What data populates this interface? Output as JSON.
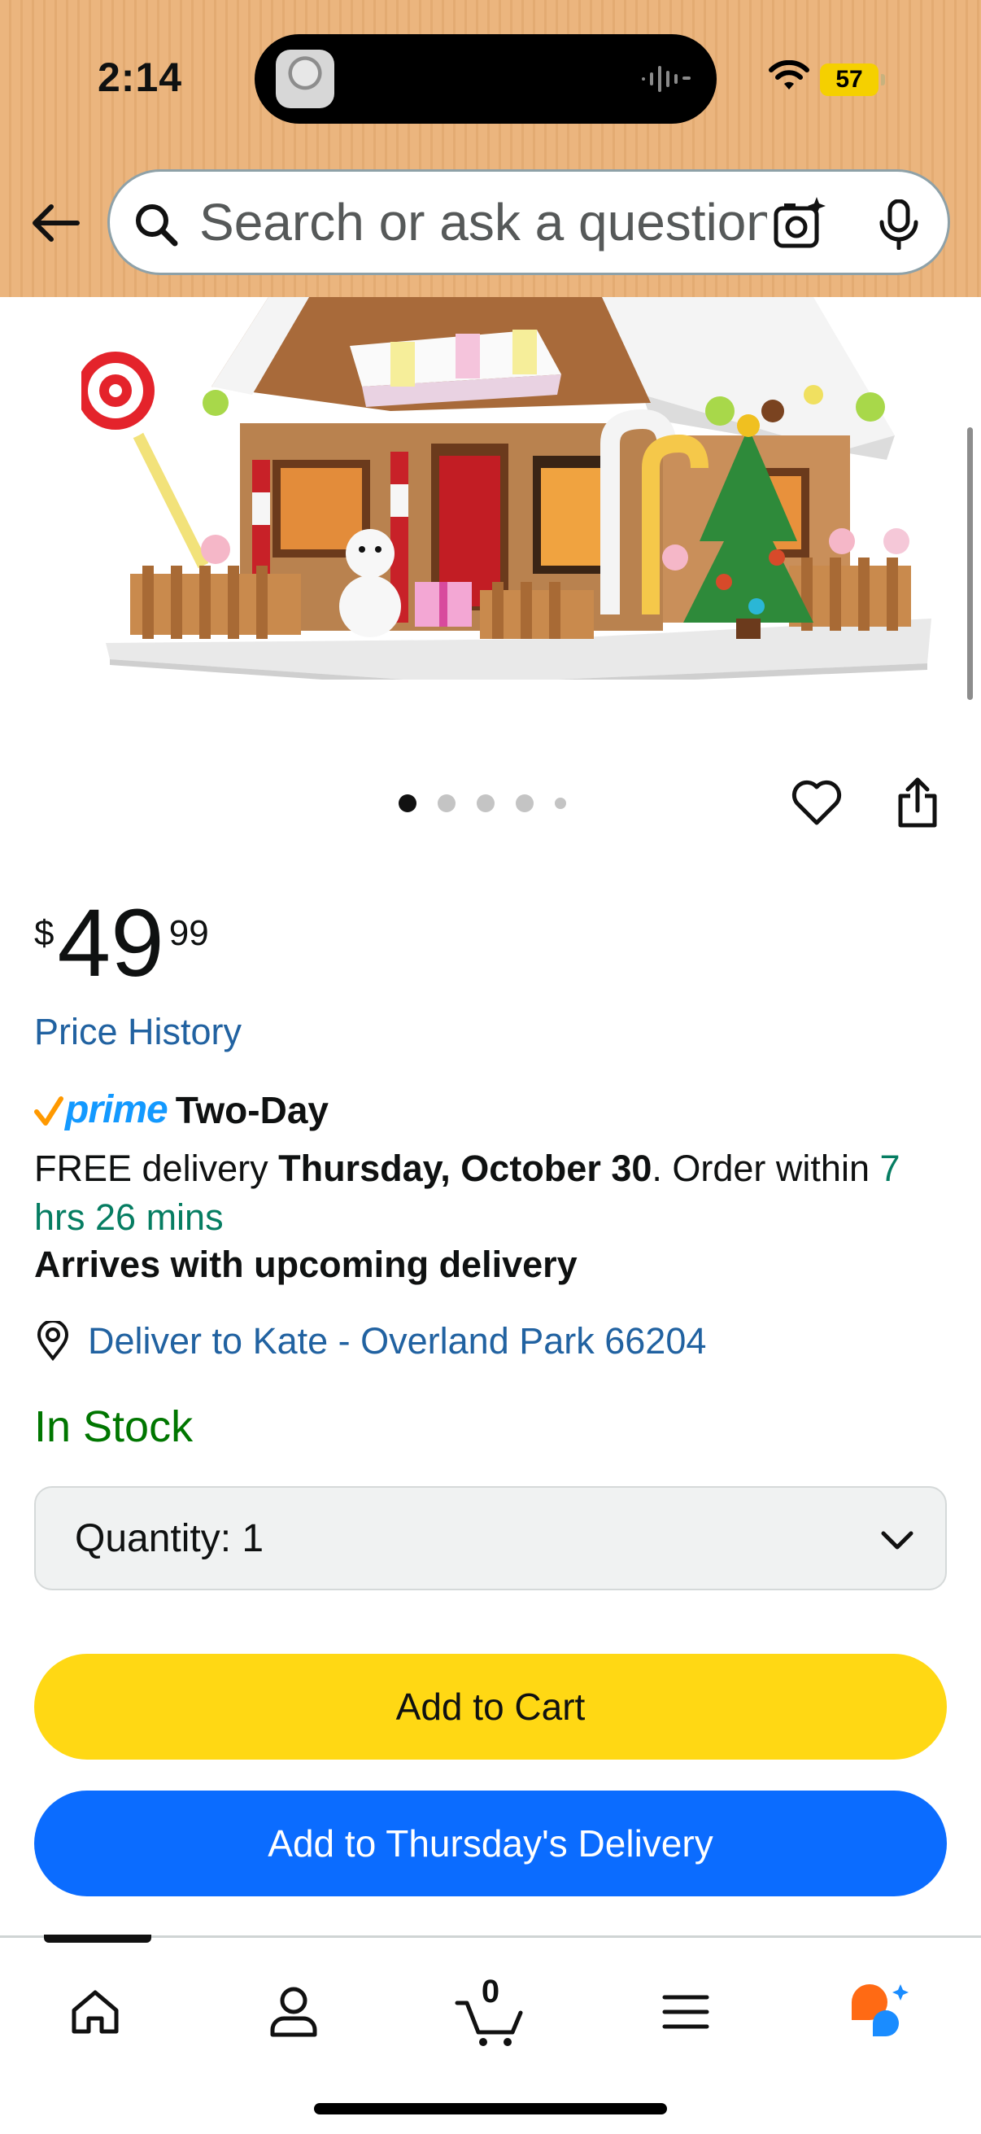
{
  "status_bar": {
    "time": "2:14",
    "battery": "57"
  },
  "search": {
    "placeholder": "Search or ask a question"
  },
  "gallery": {
    "image_count": 5,
    "active_index": 0
  },
  "price": {
    "currency_symbol": "$",
    "whole": "49",
    "fraction": "99"
  },
  "price_history_label": "Price History",
  "prime": {
    "brand": "prime",
    "type": "Two-Day"
  },
  "delivery": {
    "prefix": "FREE delivery ",
    "date": "Thursday, October 30",
    "middle": ". Order within ",
    "countdown": "7 hrs 26 mins",
    "note": "Arrives with upcoming delivery"
  },
  "deliver_to": "Deliver to Kate - Overland Park 66204",
  "stock_status": "In Stock",
  "quantity_label": "Quantity: 1",
  "buttons": {
    "add_to_cart": "Add to Cart",
    "add_to_delivery": "Add to Thursday's Delivery"
  },
  "bottom_nav": {
    "cart_count": "0",
    "items": [
      "home",
      "account",
      "cart",
      "menu",
      "rufus"
    ]
  },
  "colors": {
    "header_bg": "#ebb57e",
    "link": "#2162a1",
    "in_stock": "#007600",
    "countdown": "#067d62",
    "add_to_cart": "#ffd814",
    "add_to_delivery": "#0b6cff",
    "prime_blue": "#1399ff",
    "prime_check": "#ff9900"
  }
}
